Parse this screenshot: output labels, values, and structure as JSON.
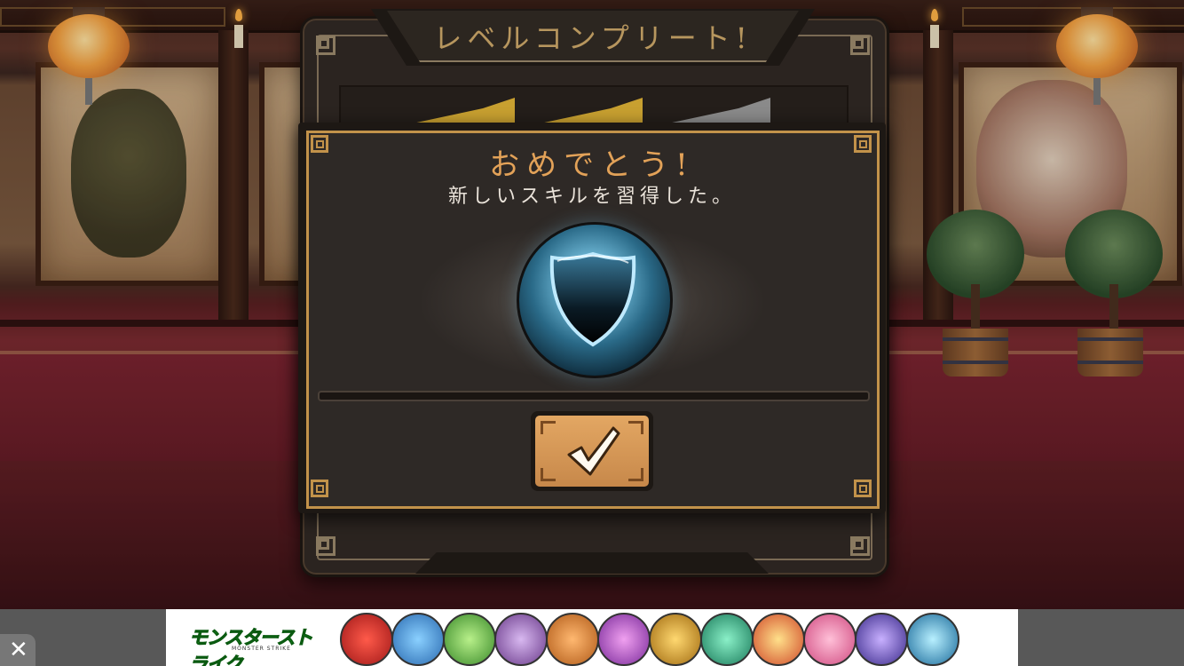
{
  "back_panel": {
    "title": "レベルコンプリート!"
  },
  "dialog": {
    "heading": "おめでとう!",
    "message": "新しいスキルを習得した。",
    "skill_icon": "shield-icon",
    "confirm_icon": "checkmark-icon"
  },
  "ad": {
    "logo_text": "モンスターストライク",
    "logo_sub": "MONSTER STRIKE",
    "close_label": "✕",
    "character_icons": [
      "red",
      "blue",
      "green",
      "purple",
      "orange",
      "violet",
      "gold",
      "teal",
      "multicolor",
      "pink",
      "indigo",
      "aqua"
    ]
  },
  "colors": {
    "accent_gold": "#c2924a",
    "heading_orange": "#e3a258",
    "button_gold": "#d39a58"
  }
}
